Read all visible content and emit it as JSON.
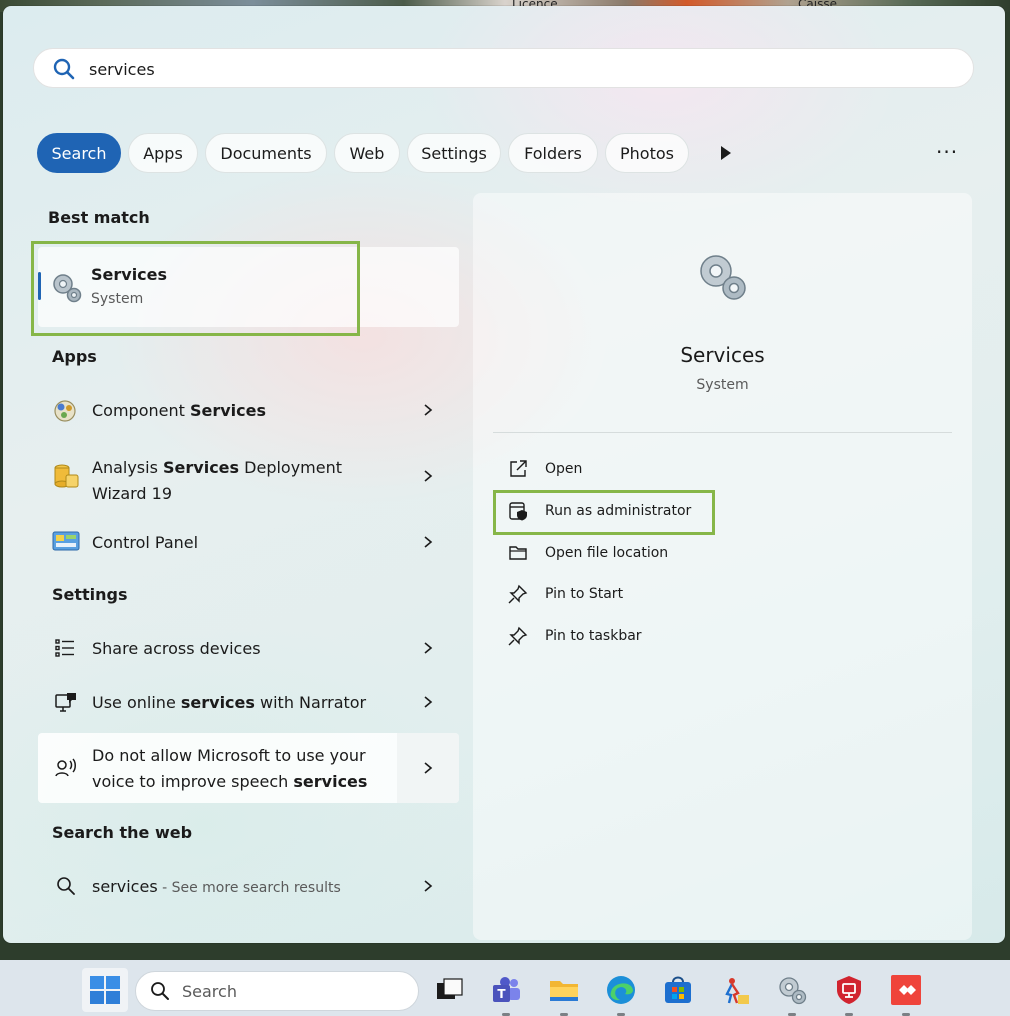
{
  "desktop": {
    "peek_left": "Licence",
    "peek_right": "Caisse"
  },
  "search": {
    "query": "services",
    "placeholder": ""
  },
  "filters": {
    "items": [
      "Search",
      "Apps",
      "Documents",
      "Web",
      "Settings",
      "Folders",
      "Photos"
    ],
    "active": "Search",
    "more_icon": "play-arrow-icon",
    "overflow_icon": "ellipsis-icon"
  },
  "best_match": {
    "heading": "Best match",
    "title": "Services",
    "subtitle": "System",
    "icon": "gears-icon"
  },
  "apps": {
    "heading": "Apps",
    "items": [
      {
        "pre": "Component ",
        "bold": "Services",
        "post": "",
        "icon": "component-services-icon"
      },
      {
        "pre": "Analysis ",
        "bold": "Services",
        "post": " Deployment",
        "line2": "Wizard 19",
        "icon": "analysis-services-icon"
      },
      {
        "pre": "Control Panel",
        "bold": "",
        "post": "",
        "icon": "control-panel-icon"
      }
    ]
  },
  "settings": {
    "heading": "Settings",
    "items": [
      {
        "pre": "Share across devices",
        "bold": "",
        "post": "",
        "icon": "share-list-icon"
      },
      {
        "pre": "Use online ",
        "bold": "services",
        "post": " with Narrator",
        "icon": "narrator-icon"
      },
      {
        "pre": "Do not allow Microsoft to use your",
        "line2pre": "voice to improve speech ",
        "line2bold": "services",
        "icon": "speech-icon"
      }
    ]
  },
  "web": {
    "heading": "Search the web",
    "query": "services",
    "suffix": " - See more search results",
    "icon": "search-icon"
  },
  "detail": {
    "title": "Services",
    "subtitle": "System",
    "actions": [
      {
        "label": "Open",
        "icon": "open-external-icon"
      },
      {
        "label": "Run as administrator",
        "icon": "admin-shield-icon"
      },
      {
        "label": "Open file location",
        "icon": "folder-icon"
      },
      {
        "label": "Pin to Start",
        "icon": "pin-icon"
      },
      {
        "label": "Pin to taskbar",
        "icon": "pin-icon"
      }
    ]
  },
  "taskbar": {
    "search_label": "Search",
    "apps": [
      "start-icon",
      "task-view-icon",
      "teams-icon",
      "file-explorer-icon",
      "edge-icon",
      "store-icon",
      "app-icon",
      "services-icon",
      "security-icon",
      "anydesk-icon"
    ]
  },
  "colors": {
    "accent": "#1f64b4",
    "highlight_box": "#86b648"
  }
}
